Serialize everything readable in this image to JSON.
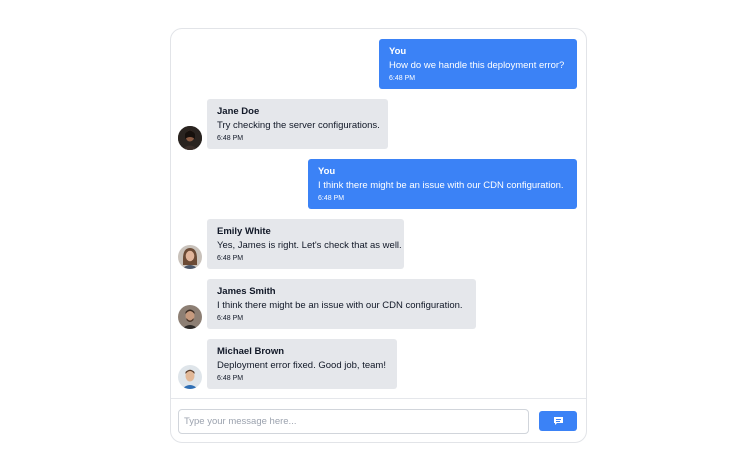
{
  "composer": {
    "placeholder": "Type your message here...",
    "send_icon": "message-icon"
  },
  "colors": {
    "outgoing_bubble": "#3b82f6",
    "incoming_bubble": "#e5e7eb",
    "send_button": "#3b82f6"
  },
  "messages": [
    {
      "direction": "outgoing",
      "sender": "You",
      "text": "How do we handle this deployment error?",
      "time": "6:48 PM"
    },
    {
      "direction": "incoming",
      "sender": "Jane Doe",
      "text": "Try checking the server configurations.",
      "time": "6:48 PM"
    },
    {
      "direction": "outgoing",
      "sender": "You",
      "text": "I think there might be an issue with our CDN configuration.",
      "time": "6:48 PM"
    },
    {
      "direction": "incoming",
      "sender": "Emily White",
      "text": "Yes, James is right. Let's check that as well.",
      "time": "6:48 PM"
    },
    {
      "direction": "incoming",
      "sender": "James Smith",
      "text": "I think there might be an issue with our CDN configuration.",
      "time": "6:48 PM"
    },
    {
      "direction": "incoming",
      "sender": "Michael Brown",
      "text": "Deployment error fixed. Good job, team!",
      "time": "6:48 PM"
    }
  ]
}
